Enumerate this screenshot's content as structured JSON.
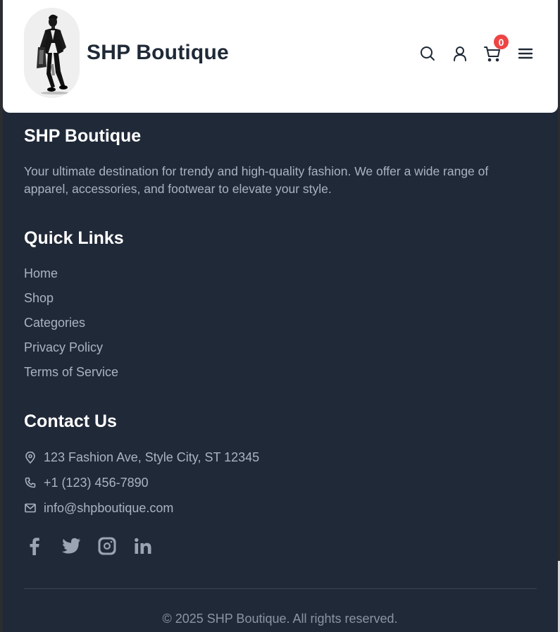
{
  "header": {
    "brand_name": "SHP Boutique",
    "cart_count": "0",
    "icons": [
      "search-icon",
      "user-icon",
      "cart-icon",
      "menu-icon"
    ]
  },
  "about": {
    "title": "SHP Boutique",
    "text": "Your ultimate destination for trendy and high-quality fashion. We offer a wide range of apparel, accessories, and footwear to elevate your style."
  },
  "quick_links": {
    "title": "Quick Links",
    "items": [
      {
        "label": "Home"
      },
      {
        "label": "Shop"
      },
      {
        "label": "Categories"
      },
      {
        "label": "Privacy Policy"
      },
      {
        "label": "Terms of Service"
      }
    ]
  },
  "contact": {
    "title": "Contact Us",
    "address": "123 Fashion Ave, Style City, ST 12345",
    "phone": "+1 (123) 456-7890",
    "email": "info@shpboutique.com"
  },
  "social": [
    "facebook-icon",
    "twitter-icon",
    "instagram-icon",
    "linkedin-icon"
  ],
  "footer": {
    "copyright": "© 2025 SHP Boutique. All rights reserved."
  },
  "colors": {
    "background": "#202938",
    "header_bg": "#ffffff",
    "heading": "#ffffff",
    "muted_text": "#aab3c0",
    "badge": "#ef4444",
    "brand_text": "#1f2937"
  }
}
